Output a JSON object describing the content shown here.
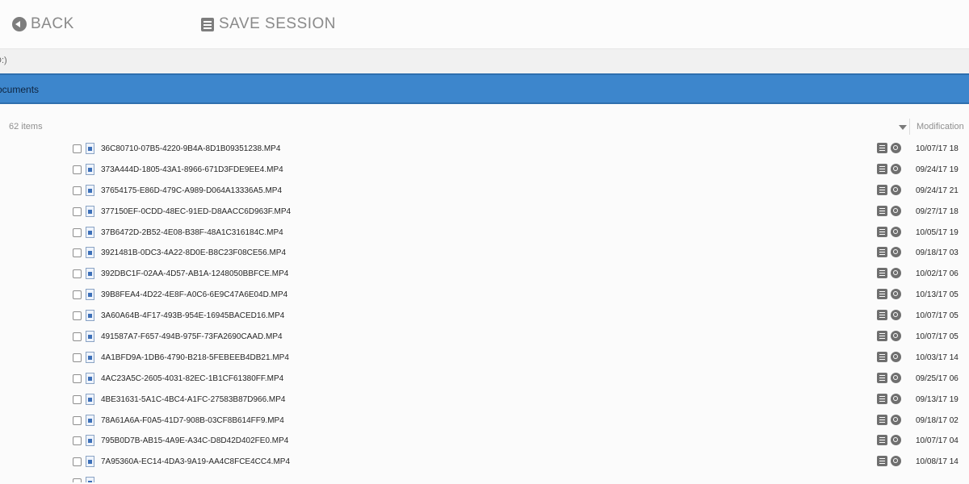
{
  "toolbar": {
    "back_label": "BACK",
    "save_label": "SAVE SESSION"
  },
  "path": {
    "label": "D:)"
  },
  "folder": {
    "name": "ocuments"
  },
  "list": {
    "count_label": "62 items",
    "modified_header": "Modification",
    "files": [
      {
        "name": "36C80710-07B5-4220-9B4A-8D1B09351238.MP4",
        "date": "10/07/17 18"
      },
      {
        "name": "373A444D-1805-43A1-8966-671D3FDE9EE4.MP4",
        "date": "09/24/17 19"
      },
      {
        "name": "37654175-E86D-479C-A989-D064A13336A5.MP4",
        "date": "09/24/17 21"
      },
      {
        "name": "377150EF-0CDD-48EC-91ED-D8AACC6D963F.MP4",
        "date": "09/27/17 18"
      },
      {
        "name": "37B6472D-2B52-4E08-B38F-48A1C316184C.MP4",
        "date": "10/05/17 19"
      },
      {
        "name": "3921481B-0DC3-4A22-8D0E-B8C23F08CE56.MP4",
        "date": "09/18/17 03"
      },
      {
        "name": "392DBC1F-02AA-4D57-AB1A-1248050BBFCE.MP4",
        "date": "10/02/17 06"
      },
      {
        "name": "39B8FEA4-4D22-4E8F-A0C6-6E9C47A6E04D.MP4",
        "date": "10/13/17 05"
      },
      {
        "name": "3A60A64B-4F17-493B-954E-16945BACED16.MP4",
        "date": "10/07/17 05"
      },
      {
        "name": "491587A7-F657-494B-975F-73FA2690CAAD.MP4",
        "date": "10/07/17 05"
      },
      {
        "name": "4A1BFD9A-1DB6-4790-B218-5FEBEEB4DB21.MP4",
        "date": "10/03/17 14"
      },
      {
        "name": "4AC23A5C-2605-4031-82EC-1B1CF61380FF.MP4",
        "date": "09/25/17 06"
      },
      {
        "name": "4BE31631-5A1C-4BC4-A1FC-27583B87D966.MP4",
        "date": "09/13/17 19"
      },
      {
        "name": "78A61A6A-F0A5-41D7-908B-03CF8B614FF9.MP4",
        "date": "09/18/17 02"
      },
      {
        "name": "795B0D7B-AB15-4A9E-A34C-D8D42D402FE0.MP4",
        "date": "10/07/17 04"
      },
      {
        "name": "7A95360A-EC14-4DA3-9A19-AA4C8FCE4CC4.MP4",
        "date": "10/08/17 14"
      }
    ]
  },
  "icons": {
    "back": "back-circle-icon",
    "save": "save-list-icon",
    "file": "file-icon",
    "details": "details-icon",
    "search": "search-icon"
  },
  "colors": {
    "folder_bar": "#3d86cc",
    "toolbar_text": "#8a8a8a"
  }
}
